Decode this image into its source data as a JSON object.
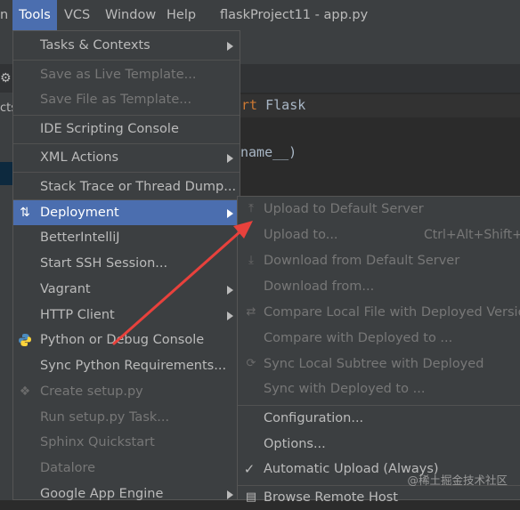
{
  "menubar": {
    "items": [
      {
        "label": "n"
      },
      {
        "label": "Tools"
      },
      {
        "label": "VCS"
      },
      {
        "label": "Window"
      },
      {
        "label": "Help"
      }
    ],
    "project_title": "flaskProject11 - app.py"
  },
  "editor": {
    "line1_keyword": "ort",
    "line1_ident": "Flask",
    "line2": "name__)"
  },
  "side_panel": {
    "text": "cts"
  },
  "tools_menu": {
    "items": [
      {
        "label": "Tasks & Contexts"
      },
      {
        "label": "Save as Live Template..."
      },
      {
        "label": "Save File as Template..."
      },
      {
        "label": "IDE Scripting Console"
      },
      {
        "label": "XML Actions"
      },
      {
        "label": "Stack Trace or Thread Dump..."
      },
      {
        "label": "Deployment"
      },
      {
        "label": "BetterIntelliJ"
      },
      {
        "label": "Start SSH Session..."
      },
      {
        "label": "Vagrant"
      },
      {
        "label": "HTTP Client"
      },
      {
        "label": "Python or Debug Console"
      },
      {
        "label": "Sync Python Requirements..."
      },
      {
        "label": "Create setup.py"
      },
      {
        "label": "Run setup.py Task..."
      },
      {
        "label": "Sphinx Quickstart"
      },
      {
        "label": "Datalore"
      },
      {
        "label": "Google App Engine"
      }
    ]
  },
  "deployment_menu": {
    "items": [
      {
        "label": "Upload to Default Server"
      },
      {
        "label": "Upload to...",
        "shortcut": "Ctrl+Alt+Shift+X"
      },
      {
        "label": "Download from Default Server"
      },
      {
        "label": "Download from..."
      },
      {
        "label": "Compare Local File with Deployed Version"
      },
      {
        "label": "Compare with Deployed to ..."
      },
      {
        "label": "Sync Local Subtree with Deployed"
      },
      {
        "label": "Sync with Deployed to ..."
      },
      {
        "label": "Configuration..."
      },
      {
        "label": "Options..."
      },
      {
        "label": "Automatic Upload (Always)"
      },
      {
        "label": "Browse Remote Host"
      }
    ]
  },
  "watermark": "@稀土掘金技术社区",
  "colors": {
    "selection": "#4b6eaf",
    "menu_bg": "#3c3f41",
    "disabled_text": "#777777",
    "annotation_arrow": "#e8413c"
  }
}
